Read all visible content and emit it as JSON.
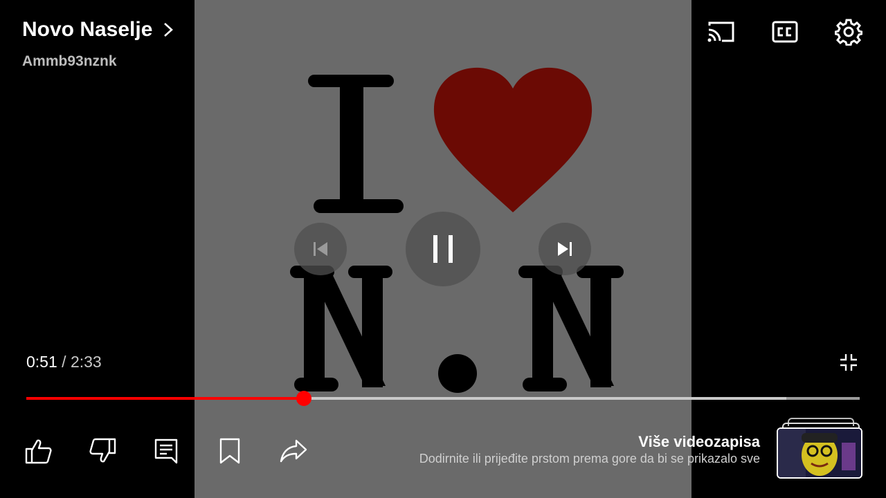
{
  "header": {
    "title": "Novo Naselje",
    "channel": "Ammb93nznk"
  },
  "icons": {
    "cast": "cast-icon",
    "captions": "closed-captions-icon",
    "settings": "gear-icon",
    "chevron": "chevron-right-icon",
    "previous": "skip-previous-icon",
    "pause": "pause-icon",
    "next": "skip-next-icon",
    "exit_fullscreen": "exit-fullscreen-icon",
    "like": "thumbs-up-icon",
    "dislike": "thumbs-down-icon",
    "comments": "comment-icon",
    "save": "bookmark-icon",
    "share": "share-icon"
  },
  "video": {
    "art_letters": [
      "I",
      "N",
      "N"
    ],
    "heart_color": "#6b0a04"
  },
  "playback": {
    "current_time": "0:51",
    "separator": "/",
    "duration": "2:33",
    "progress_fraction": 0.333,
    "buffered_fraction": 0.912
  },
  "more_videos": {
    "title": "Više videozapisa",
    "subtitle": "Dodirnite ili prijeđite prstom prema gore da bi se prikazalo sve"
  },
  "colors": {
    "accent": "#ff0000",
    "video_background": "#6a6a6a"
  }
}
